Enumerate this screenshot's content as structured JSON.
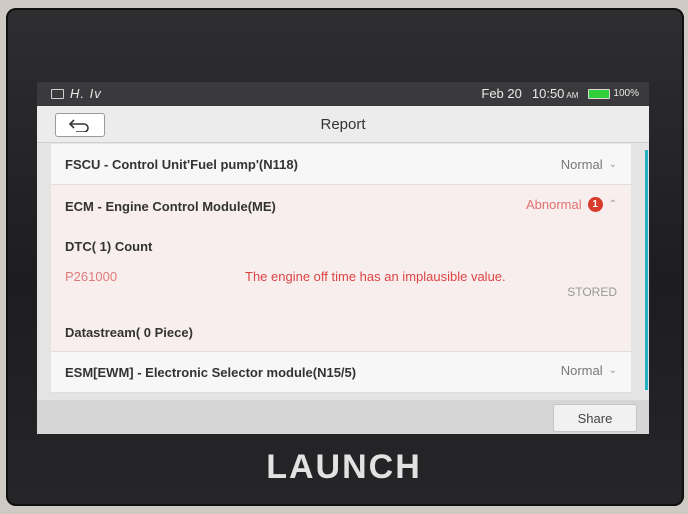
{
  "status_bar": {
    "left_text": "H. Iv",
    "date": "Feb 20",
    "time": "10:50",
    "ampm": "AM",
    "battery": "100%",
    "colors": {
      "battery": "#2fcf3a"
    }
  },
  "header": {
    "title": "Report"
  },
  "modules": [
    {
      "label": "FSCU - Control Unit'Fuel pump'(N118)",
      "status": "Normal"
    },
    {
      "label": "ECM - Engine Control Module(ME)",
      "status": "Abnormal",
      "badge": "1"
    },
    {
      "label": "ESM[EWM] - Electronic Selector module(N15/5)",
      "status": "Normal"
    }
  ],
  "ecm_details": {
    "dtc_count_label": "DTC( 1) Count",
    "dtc": {
      "code": "P261000",
      "description": "The engine off time has an implausible value.",
      "state": "STORED"
    },
    "datastream_label": "Datastream( 0 Piece)"
  },
  "footer": {
    "share_label": "Share"
  },
  "brand": "LAUNCH",
  "colors": {
    "abnormal": "#e07070",
    "badge": "#d83a2c",
    "dtc_text": "#d44444"
  }
}
